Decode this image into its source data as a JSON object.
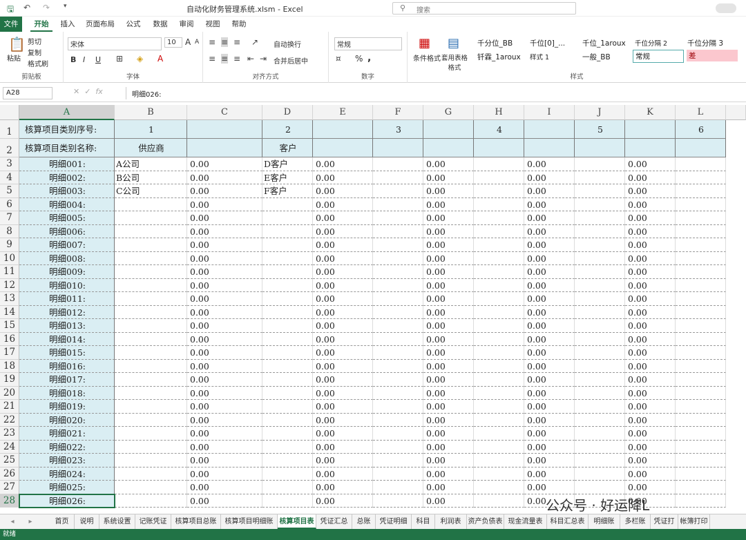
{
  "app": {
    "title": "自动化财务管理系统.xlsm  -  Excel",
    "search_placeholder": "搜索",
    "status": "就绪"
  },
  "icons": {
    "save": "save-icon",
    "undo": "undo-icon",
    "redo": "redo-icon",
    "customize": "customize-icon",
    "search": "search-icon"
  },
  "menu": {
    "file": "文件",
    "tabs": [
      "开始",
      "插入",
      "页面布局",
      "公式",
      "数据",
      "审阅",
      "视图",
      "帮助"
    ]
  },
  "ribbon": {
    "clipboard": {
      "paste": "粘贴",
      "cut": "剪切",
      "copy": "复制",
      "format_painter": "格式刷",
      "label": "剪贴板"
    },
    "font": {
      "name": "宋体",
      "size": "10",
      "grow": "A",
      "shrink": "A",
      "bold": "B",
      "italic": "I",
      "underline": "U",
      "label": "字体"
    },
    "align": {
      "wrap": "自动换行",
      "merge": "合并后居中",
      "label": "对齐方式"
    },
    "number": {
      "format": "常规",
      "percent": "%",
      "comma": ",",
      "label": "数字"
    },
    "styles": {
      "cond_format": "条件格式",
      "table_format": "套用表格格式",
      "label": "样式",
      "items": [
        "千分位_BB",
        "千位[0]_...",
        "千位_1aroux",
        "千位分隔 2",
        "千位分隔 3",
        "钎霖_1aroux",
        "样式 1",
        "一般_BB",
        "常规",
        "差"
      ]
    }
  },
  "formula_bar": {
    "name_box": "A28",
    "fx": "fx",
    "content": "明细026:"
  },
  "grid": {
    "columns": [
      "A",
      "B",
      "C",
      "D",
      "E",
      "F",
      "G",
      "H",
      "I",
      "J",
      "K",
      "L"
    ],
    "row_numbers": [
      1,
      2,
      3,
      4,
      5,
      6,
      7,
      8,
      9,
      10,
      11,
      12,
      13,
      14,
      15,
      16,
      17,
      18,
      19,
      20,
      21,
      22,
      23,
      24,
      25,
      26,
      27,
      28
    ],
    "row1": {
      "a": "核算项目类别序号:",
      "b": "1",
      "d": "2",
      "f": "3",
      "h": "4",
      "j": "5",
      "l": "6"
    },
    "row2": {
      "a": "核算项目类别名称:",
      "b": "供应商",
      "d": "客户"
    },
    "detail_labels": [
      "明细001:",
      "明细002:",
      "明细003:",
      "明细004:",
      "明细005:",
      "明细006:",
      "明细007:",
      "明细008:",
      "明细009:",
      "明细010:",
      "明细011:",
      "明细012:",
      "明细013:",
      "明细014:",
      "明细015:",
      "明细016:",
      "明细017:",
      "明细018:",
      "明细019:",
      "明细020:",
      "明细021:",
      "明细022:",
      "明细023:",
      "明细024:",
      "明细025:",
      "明细026:"
    ],
    "b_values": [
      "A公司",
      "B公司",
      "C公司"
    ],
    "d_values": [
      "D客户",
      "E客户",
      "F客户"
    ],
    "zero": "0.00"
  },
  "sheets": {
    "nav_prev": "◂",
    "nav_next": "▸",
    "tabs": [
      "首页",
      "说明",
      "系统设置",
      "记账凭证",
      "核算项目总账",
      "核算项目明细账",
      "核算项目表",
      "凭证汇总",
      "总账",
      "凭证明细",
      "科目",
      "利润表",
      "资产负债表",
      "现金流量表",
      "科目汇总表",
      "明细账",
      "多栏账",
      "凭证打",
      "帐簿打印"
    ],
    "active": 6
  },
  "watermark": "公众号 · 好运降L"
}
